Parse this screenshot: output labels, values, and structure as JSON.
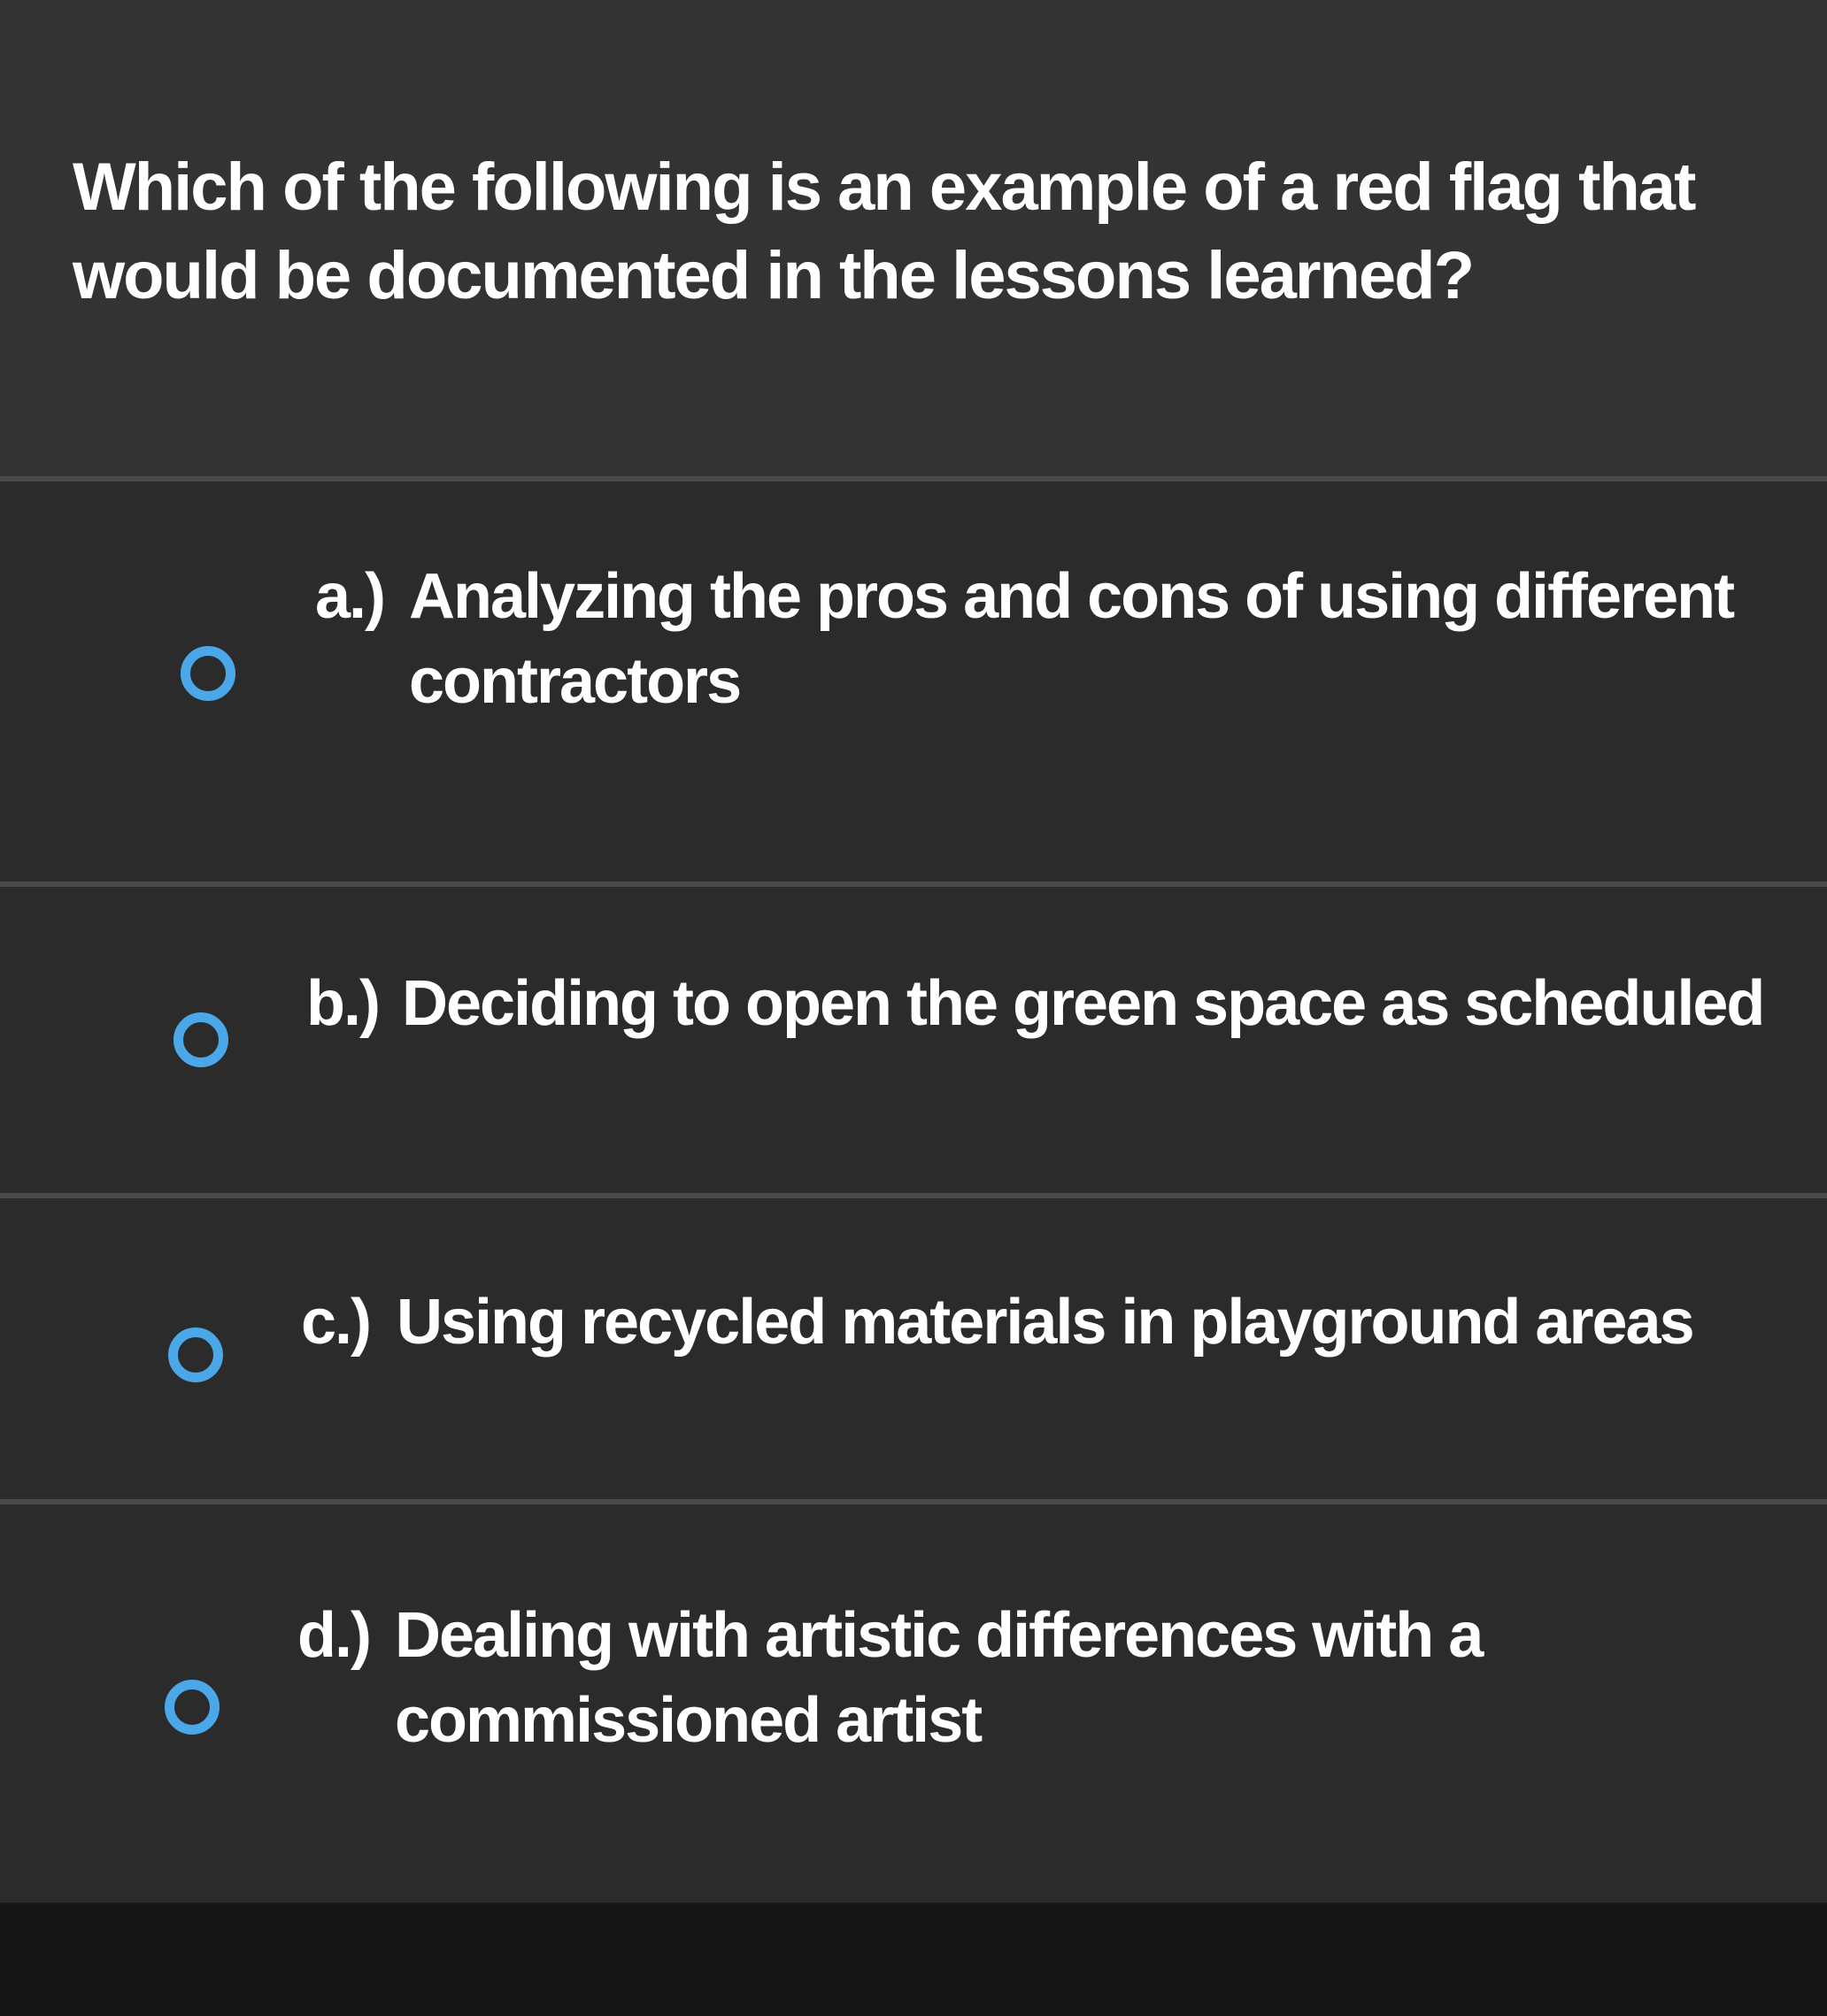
{
  "question": {
    "text": "Which of the following is an example of a red flag that would be documented in the lessons learned?"
  },
  "options": [
    {
      "letter": "a.)",
      "text": "Analyzing the pros and cons of using different contractors"
    },
    {
      "letter": "b.)",
      "text": "Deciding to open the green space as scheduled"
    },
    {
      "letter": "c.)",
      "text": "Using recycled materials in playground areas"
    },
    {
      "letter": "d.)",
      "text": "Dealing with artistic differences with a commissioned artist"
    }
  ],
  "colors": {
    "radio_accent": "#4aa8e8",
    "text": "#ffffff",
    "background": "#2f2f2f"
  }
}
